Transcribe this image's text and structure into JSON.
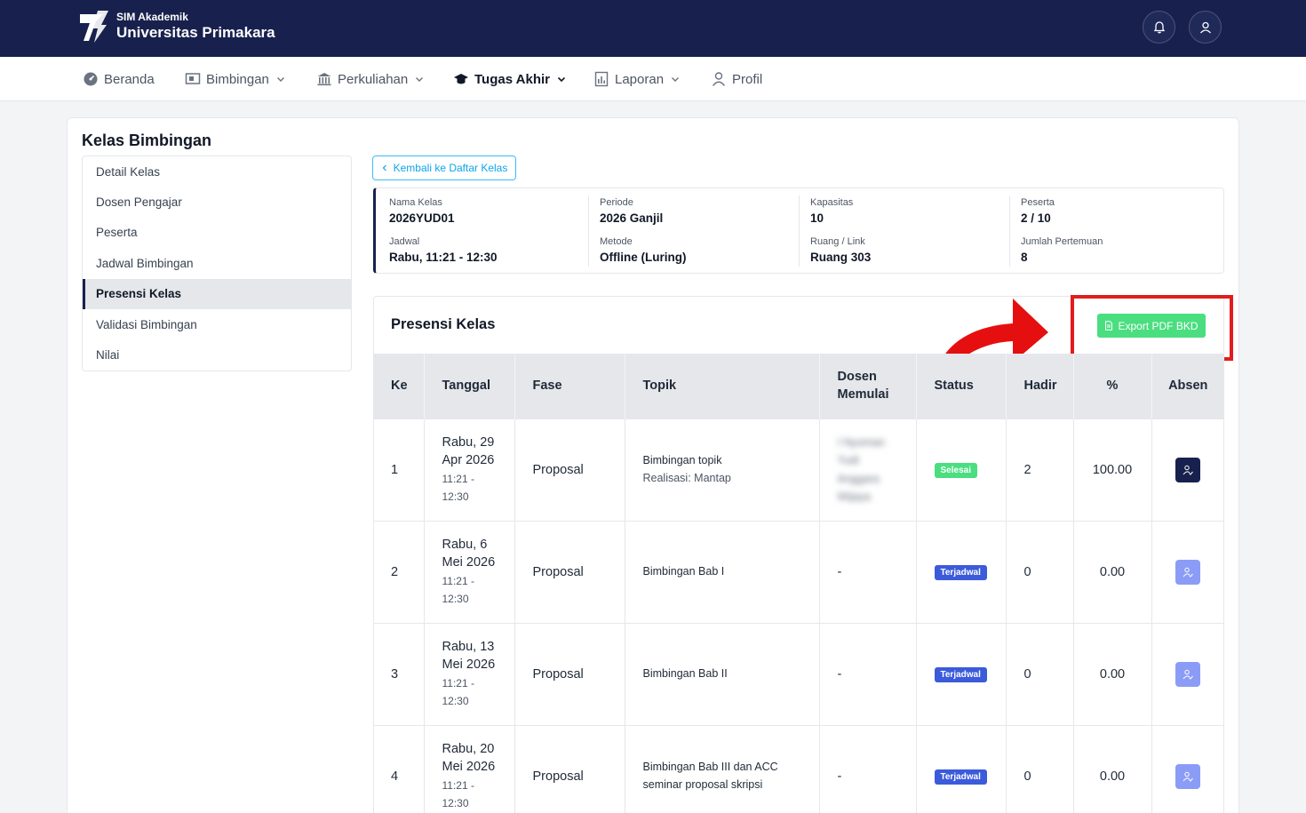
{
  "header": {
    "app_name": "SIM Akademik",
    "university": "Universitas Primakara"
  },
  "nav": [
    {
      "label": "Beranda",
      "icon": "dashboard-icon"
    },
    {
      "label": "Bimbingan",
      "icon": "board-icon"
    },
    {
      "label": "Perkuliahan",
      "icon": "building-icon"
    },
    {
      "label": "Tugas Akhir",
      "icon": "graduation-cap-icon"
    },
    {
      "label": "Laporan",
      "icon": "report-icon"
    },
    {
      "label": "Profil",
      "icon": "user-icon"
    }
  ],
  "page": {
    "title": "Kelas Bimbingan",
    "back_label": "Kembali ke Daftar Kelas"
  },
  "sidemenu": [
    "Detail Kelas",
    "Dosen Pengajar",
    "Peserta",
    "Jadwal Bimbingan",
    "Presensi Kelas",
    "Validasi Bimbingan",
    "Nilai"
  ],
  "info": {
    "nama_kelas_label": "Nama Kelas",
    "nama_kelas": "2026YUD01",
    "periode_label": "Periode",
    "periode": "2026 Ganjil",
    "kapasitas_label": "Kapasitas",
    "kapasitas": "10",
    "peserta_label": "Peserta",
    "peserta": "2 / 10",
    "jadwal_label": "Jadwal",
    "jadwal": "Rabu, 11:21 - 12:30",
    "metode_label": "Metode",
    "metode": "Offline (Luring)",
    "ruang_label": "Ruang / Link",
    "ruang": "Ruang 303",
    "pertemuan_label": "Jumlah Pertemuan",
    "pertemuan": "8"
  },
  "presensi": {
    "title": "Presensi Kelas",
    "export_label": "Export PDF BKD",
    "columns": {
      "ke": "Ke",
      "tanggal": "Tanggal",
      "fase": "Fase",
      "topik": "Topik",
      "dosen_1": "Dosen",
      "dosen_2": "Memulai",
      "status": "Status",
      "hadir": "Hadir",
      "persen": "%",
      "absen": "Absen"
    },
    "rows": [
      {
        "ke": "1",
        "date_1": "Rabu, 29",
        "date_2": "Apr 2026",
        "time_1": "11:21 -",
        "time_2": "12:30",
        "fase": "Proposal",
        "topik_1": "Bimbingan topik",
        "topik_2": "Realisasi: Mantap",
        "dosen_1": "I Nyoman",
        "dosen_2": "Yudi",
        "dosen_3": "Anggara",
        "dosen_4": "Wijaya",
        "status": "Selesai",
        "hadir": "2",
        "persen": "100.00"
      },
      {
        "ke": "2",
        "date_1": "Rabu, 6",
        "date_2": "Mei 2026",
        "time_1": "11:21 -",
        "time_2": "12:30",
        "fase": "Proposal",
        "topik_1": "Bimbingan Bab I",
        "topik_2": "",
        "dosen_1": "-",
        "status": "Terjadwal",
        "hadir": "0",
        "persen": "0.00"
      },
      {
        "ke": "3",
        "date_1": "Rabu, 13",
        "date_2": "Mei 2026",
        "time_1": "11:21 -",
        "time_2": "12:30",
        "fase": "Proposal",
        "topik_1": "Bimbingan Bab II",
        "topik_2": "",
        "dosen_1": "-",
        "status": "Terjadwal",
        "hadir": "0",
        "persen": "0.00"
      },
      {
        "ke": "4",
        "date_1": "Rabu, 20",
        "date_2": "Mei 2026",
        "time_1": "11:21 -",
        "time_2": "12:30",
        "fase": "Proposal",
        "topik_1": "Bimbingan Bab III dan ACC",
        "topik_2": "seminar proposal skripsi",
        "dosen_1": "-",
        "status": "Terjadwal",
        "hadir": "0",
        "persen": "0.00"
      }
    ]
  },
  "colors": {
    "navy": "#18214d",
    "success": "#4ade80",
    "scheduled": "#3b5bdb",
    "highlight": "#e11d1d"
  }
}
